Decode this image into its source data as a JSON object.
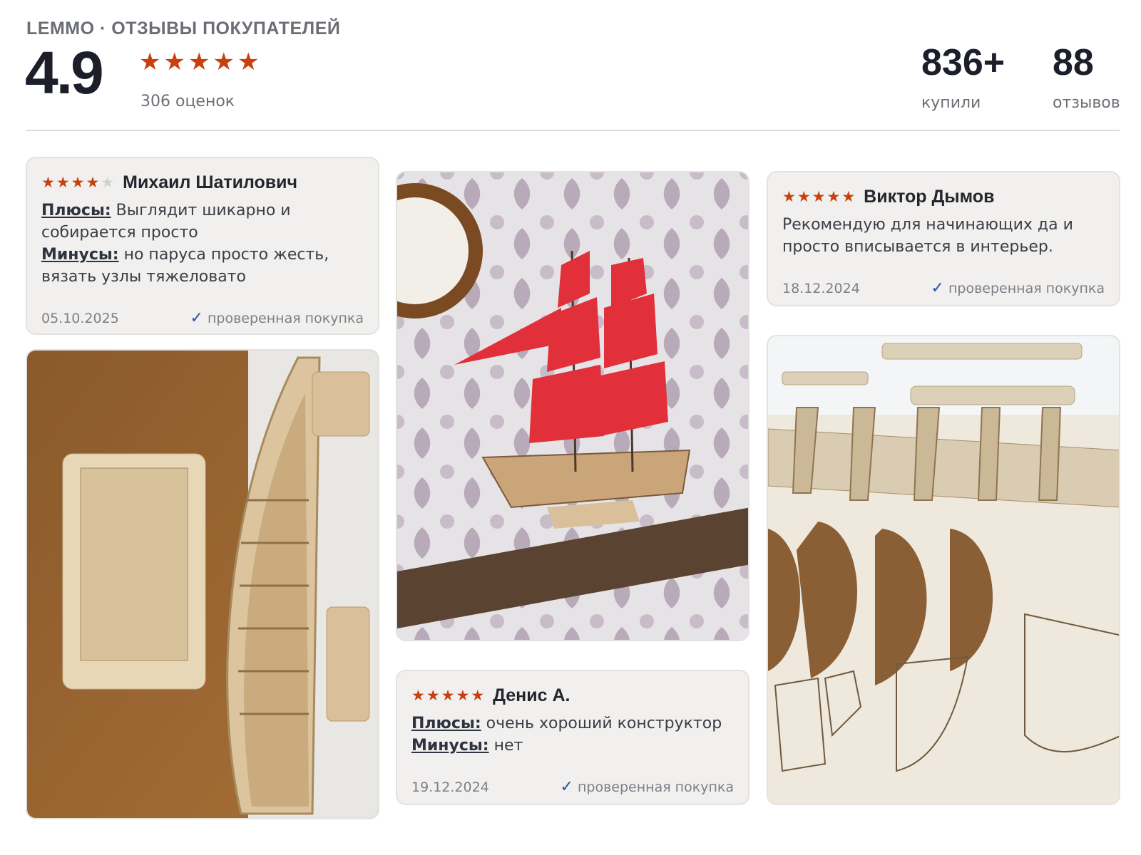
{
  "header": {
    "brand": "LEMMO · ОТЗЫВЫ ПОКУПАТЕЛЕЙ",
    "rating": "4.9",
    "rating_count": "306 оценок",
    "stats": [
      {
        "value": "836+",
        "label": "купили"
      },
      {
        "value": "88",
        "label": "отзывов"
      }
    ]
  },
  "colors": {
    "star": "#c9400f",
    "check": "#2a4fa0",
    "card_bg": "#f1f0ee"
  },
  "reviews": [
    {
      "author": "Михаил Шатилович",
      "stars": 4,
      "pros_label": "Плюсы:",
      "pros": "Выглядит шикарно и собирается просто",
      "cons_label": "Минусы:",
      "cons": "но паруса просто жесть, вязать узлы тяжеловато",
      "date": "05.10.2025",
      "verified": "проверенная покупка"
    },
    {
      "author": "Виктор Дымов",
      "stars": 5,
      "text": "Рекомендую для начинающих да и просто вписывается в интерьер.",
      "date": "18.12.2024",
      "verified": "проверенная покупка"
    },
    {
      "author": "Денис А.",
      "stars": 5,
      "pros_label": "Плюсы:",
      "pros": "очень хороший конструктор",
      "cons_label": "Минусы:",
      "cons": "нет",
      "date": "19.12.2024",
      "verified": "проверенная покупка"
    }
  ],
  "photos": [
    {
      "subject": "wooden-ship-hull-assembly"
    },
    {
      "subject": "ship-model-red-sails"
    },
    {
      "subject": "plywood-parts-sheet"
    }
  ]
}
